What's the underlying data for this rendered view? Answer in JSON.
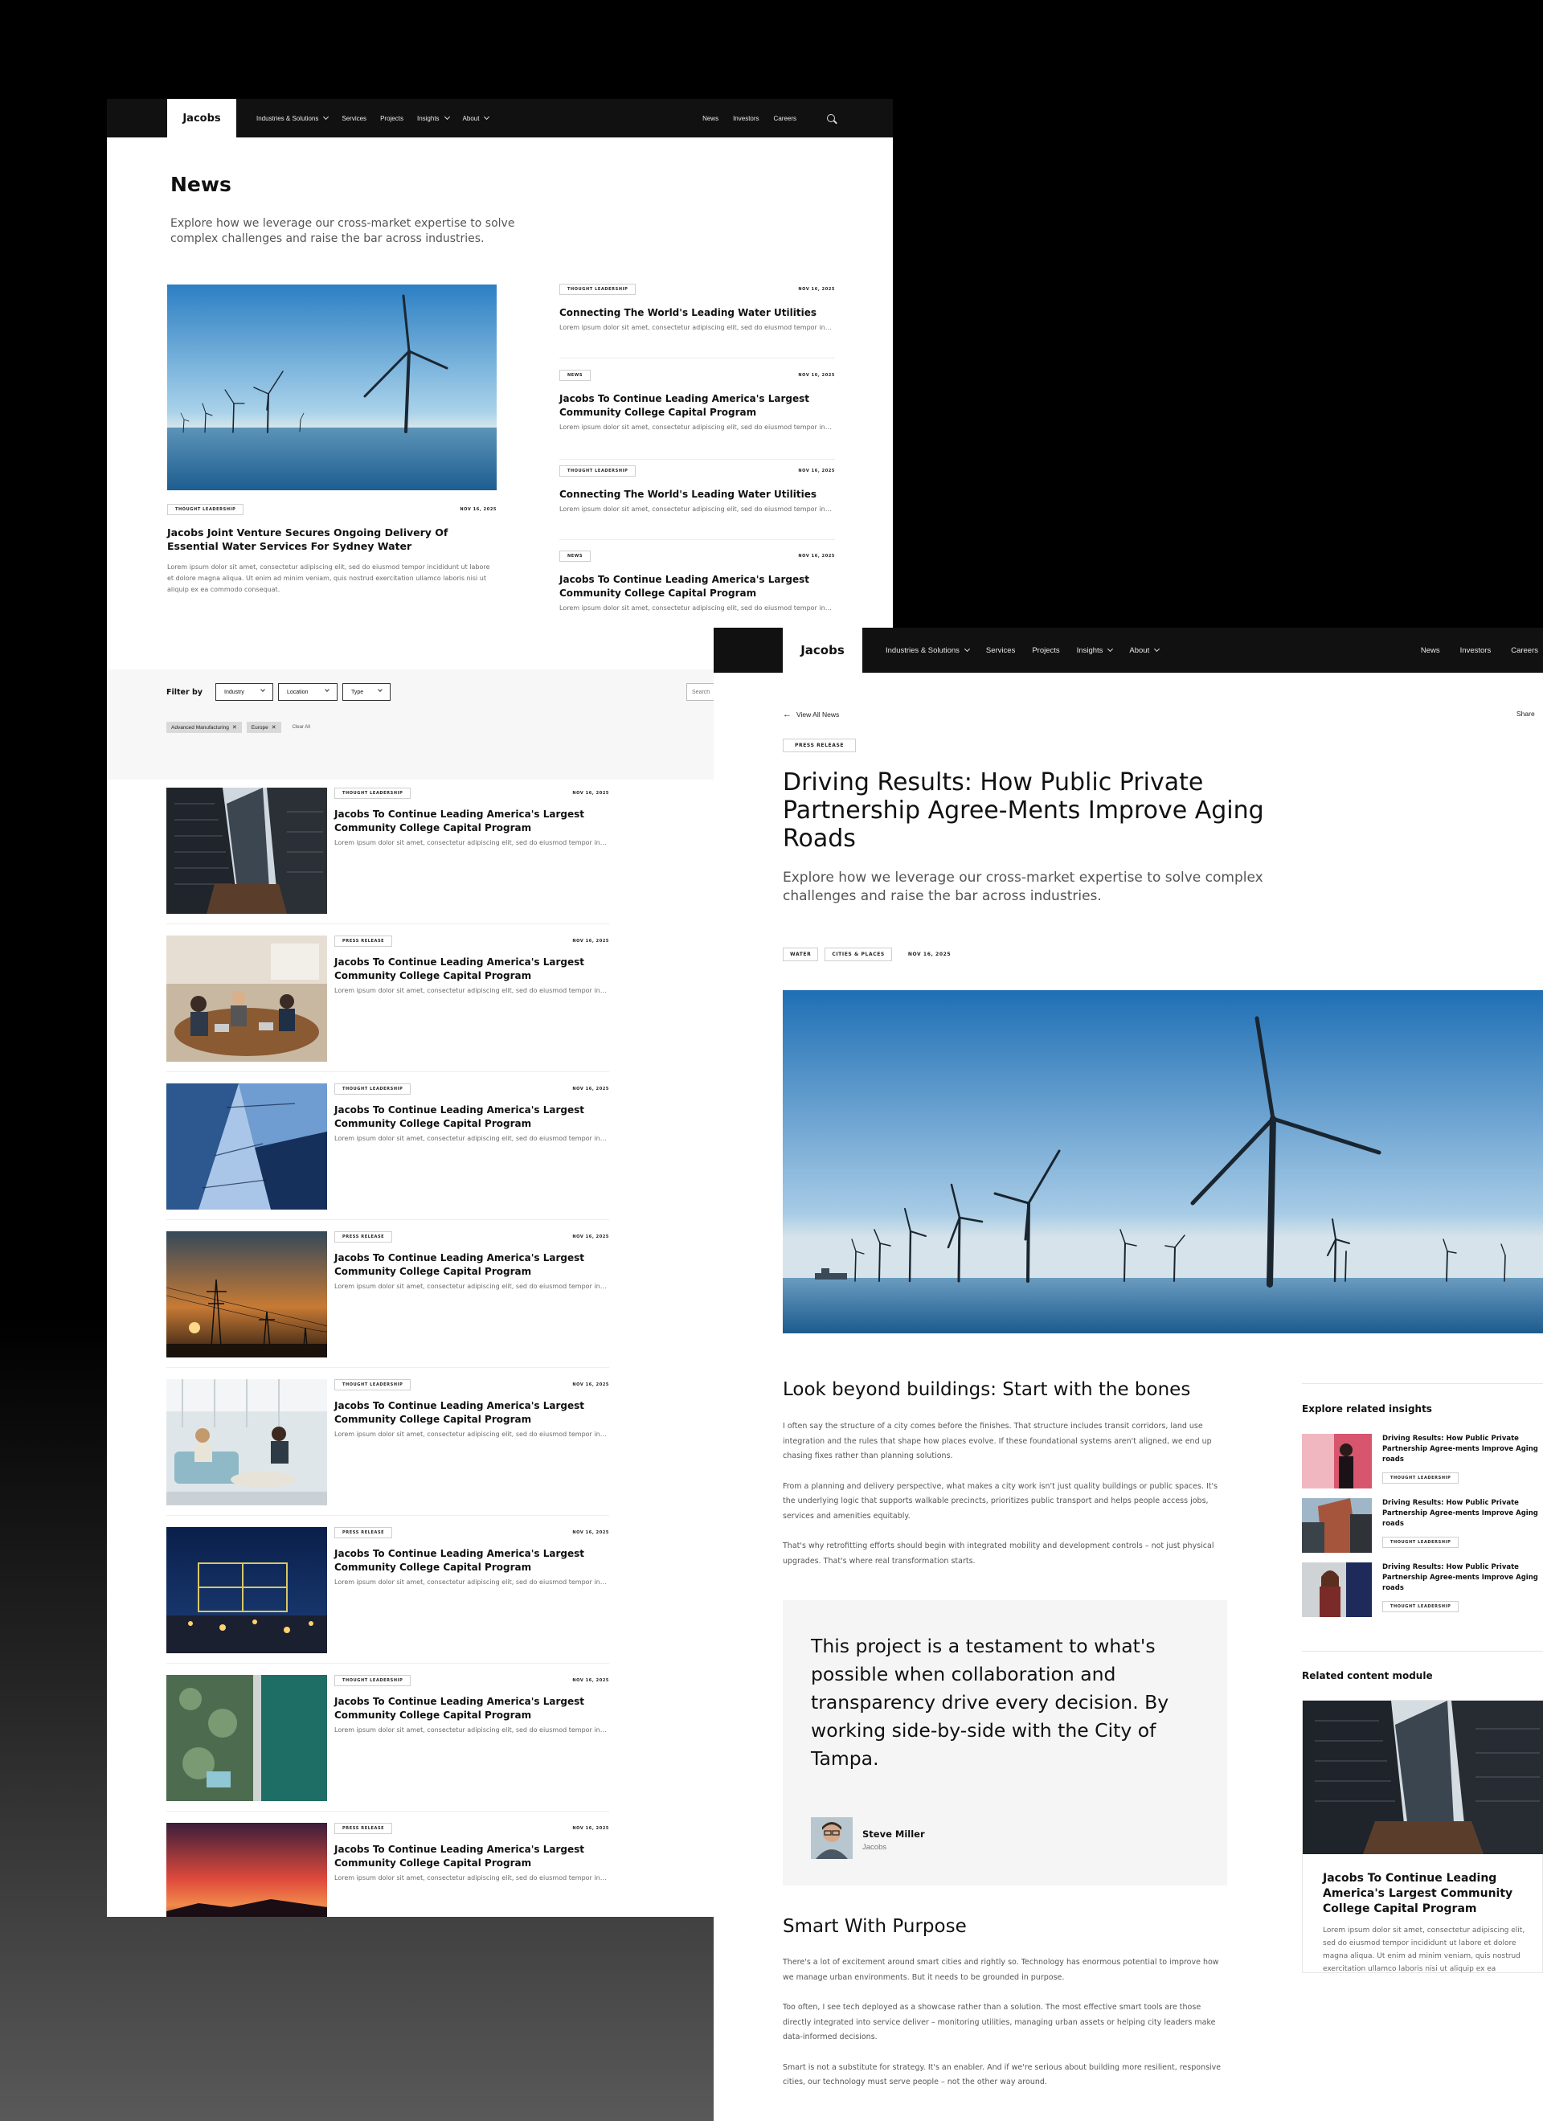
{
  "nav": {
    "logo": "Jacobs",
    "links": [
      "Industries & Solutions",
      "Services",
      "Projects",
      "Insights",
      "About"
    ],
    "right_links": [
      "News",
      "Investors",
      "Careers"
    ]
  },
  "news_page": {
    "title": "News",
    "intro": "Explore how we leverage our cross-market expertise to solve complex challenges and raise the bar across industries.",
    "featured": {
      "tag": "THOUGHT LEADERSHIP",
      "date": "NOV 16, 2025",
      "title": "Jacobs Joint Venture Secures Ongoing Delivery Of Essential Water Services For Sydney Water",
      "excerpt": "Lorem ipsum dolor sit amet, consectetur adipiscing elit, sed do eiusmod tempor incididunt ut labore et dolore magna aliqua. Ut enim ad minim veniam, quis nostrud exercitation ullamco laboris nisi ut aliquip ex ea commodo consequat."
    },
    "side_items": [
      {
        "tag": "THOUGHT LEADERSHIP",
        "date": "NOV 16, 2025",
        "title": "Connecting The World's Leading Water Utilities",
        "excerpt": "Lorem ipsum dolor sit amet, consectetur adipiscing elit, sed do eiusmod tempor incididunt"
      },
      {
        "tag": "NEWS",
        "date": "NOV 16, 2025",
        "title": "Jacobs To Continue Leading America's Largest Community College Capital Program",
        "excerpt": "Lorem ipsum dolor sit amet, consectetur adipiscing elit, sed do eiusmod tempor incididunt"
      },
      {
        "tag": "THOUGHT LEADERSHIP",
        "date": "NOV 16, 2025",
        "title": "Connecting The World's Leading Water Utilities",
        "excerpt": "Lorem ipsum dolor sit amet, consectetur adipiscing elit, sed do eiusmod tempor incididunt"
      },
      {
        "tag": "NEWS",
        "date": "NOV 16, 2025",
        "title": "Jacobs To Continue Leading America's Largest Community College Capital Program",
        "excerpt": "Lorem ipsum dolor sit amet, consectetur adipiscing elit, sed do eiusmod tempor incididunt"
      }
    ],
    "filter": {
      "label": "Filter by",
      "dropdowns": [
        "Industry",
        "Location",
        "Type"
      ],
      "search_placeholder": "Search",
      "chips": [
        "Advanced Manufacturing",
        "Europe"
      ],
      "clear": "Clear All"
    },
    "list": [
      {
        "tag": "THOUGHT LEADERSHIP",
        "date": "NOV 16, 2025",
        "title": "Jacobs To Continue Leading America's Largest Community College Capital Program",
        "excerpt": "Lorem ipsum dolor sit amet, consectetur adipiscing elit, sed do eiusmod tempor incididunt"
      },
      {
        "tag": "PRESS RELEASE",
        "date": "NOV 16, 2025",
        "title": "Jacobs To Continue Leading America's Largest Community College Capital Program",
        "excerpt": "Lorem ipsum dolor sit amet, consectetur adipiscing elit, sed do eiusmod tempor incididunt"
      },
      {
        "tag": "THOUGHT LEADERSHIP",
        "date": "NOV 16, 2025",
        "title": "Jacobs To Continue Leading America's Largest Community College Capital Program",
        "excerpt": "Lorem ipsum dolor sit amet, consectetur adipiscing elit, sed do eiusmod tempor incididunt"
      },
      {
        "tag": "PRESS RELEASE",
        "date": "NOV 16, 2025",
        "title": "Jacobs To Continue Leading America's Largest Community College Capital Program",
        "excerpt": "Lorem ipsum dolor sit amet, consectetur adipiscing elit, sed do eiusmod tempor incididunt"
      },
      {
        "tag": "THOUGHT LEADERSHIP",
        "date": "NOV 16, 2025",
        "title": "Jacobs To Continue Leading America's Largest Community College Capital Program",
        "excerpt": "Lorem ipsum dolor sit amet, consectetur adipiscing elit, sed do eiusmod tempor incididunt"
      },
      {
        "tag": "PRESS RELEASE",
        "date": "NOV 16, 2025",
        "title": "Jacobs To Continue Leading America's Largest Community College Capital Program",
        "excerpt": "Lorem ipsum dolor sit amet, consectetur adipiscing elit, sed do eiusmod tempor incididunt"
      },
      {
        "tag": "THOUGHT LEADERSHIP",
        "date": "NOV 16, 2025",
        "title": "Jacobs To Continue Leading America's Largest Community College Capital Program",
        "excerpt": "Lorem ipsum dolor sit amet, consectetur adipiscing elit, sed do eiusmod tempor incididunt"
      },
      {
        "tag": "PRESS RELEASE",
        "date": "NOV 16, 2025",
        "title": "Jacobs To Continue Leading America's Largest Community College Capital Program",
        "excerpt": "Lorem ipsum dolor sit amet, consectetur adipiscing elit, sed do eiusmod tempor incididunt"
      }
    ]
  },
  "article_page": {
    "back": "View All News",
    "share": "Share",
    "tag": "PRESS RELEASE",
    "title": "Driving Results: How Public Private Partnership Agree-Ments Improve Aging Roads",
    "intro": "Explore how we leverage our cross-market expertise to solve complex challenges and raise the bar across industries.",
    "meta_tags": [
      "WATER",
      "CITIES & PLACES"
    ],
    "date": "NOV 16, 2025",
    "section1_title": "Look beyond buildings: Start with the bones",
    "section1_paras": [
      "I often say the structure of a city comes before the finishes. That structure includes transit corridors, land use integration and the rules that shape how places evolve. If these foundational systems aren't aligned, we end up chasing fixes rather than planning solutions.",
      "From a planning and delivery perspective, what makes a city work isn't just quality buildings or public spaces. It's the underlying logic that supports walkable precincts, prioritizes public transport and helps people access jobs, services and amenities equitably.",
      "That's why retrofitting efforts should begin with integrated mobility and development controls – not just physical upgrades. That's where real transformation starts."
    ],
    "quote": "This project is a testament to what's possible when collaboration and transparency drive every decision. By working side-by-side with the City of Tampa.",
    "quote_author": "Steve Miller",
    "quote_org": "Jacobs",
    "section2_title": "Smart With Purpose",
    "section2_paras": [
      "There's a lot of excitement around smart cities and rightly so. Technology has enormous potential to improve how we manage urban environments. But it needs to be grounded in purpose.",
      "Too often, I see tech deployed as a showcase rather than a solution. The most effective smart tools are those directly integrated into service deliver – monitoring utilities, managing urban assets or helping city leaders make data-informed decisions.",
      "Smart is not a substitute for strategy. It's an enabler. And if we're serious about building more resilient, responsive cities, our technology must serve people – not the other way around."
    ],
    "related_title": "Explore related insights",
    "related": [
      {
        "title": "Driving Results: How Public Private Partnership Agree-ments Improve Aging roads",
        "tag": "THOUGHT LEADERSHIP"
      },
      {
        "title": "Driving Results: How Public Private Partnership Agree-ments Improve Aging roads",
        "tag": "THOUGHT LEADERSHIP"
      },
      {
        "title": "Driving Results: How Public Private Partnership Agree-ments Improve Aging roads",
        "tag": "THOUGHT LEADERSHIP"
      }
    ],
    "module_title": "Related content module",
    "module_card_title": "Jacobs To Continue Leading America's Largest Community College Capital Program",
    "module_card_text": "Lorem ipsum dolor sit amet, consectetur adipiscing elit, sed do eiusmod tempor incididunt ut labore et dolore magna aliqua. Ut enim ad minim veniam, quis nostrud exercitation ullamco laboris nisi ut aliquip ex ea commodo consequat."
  }
}
